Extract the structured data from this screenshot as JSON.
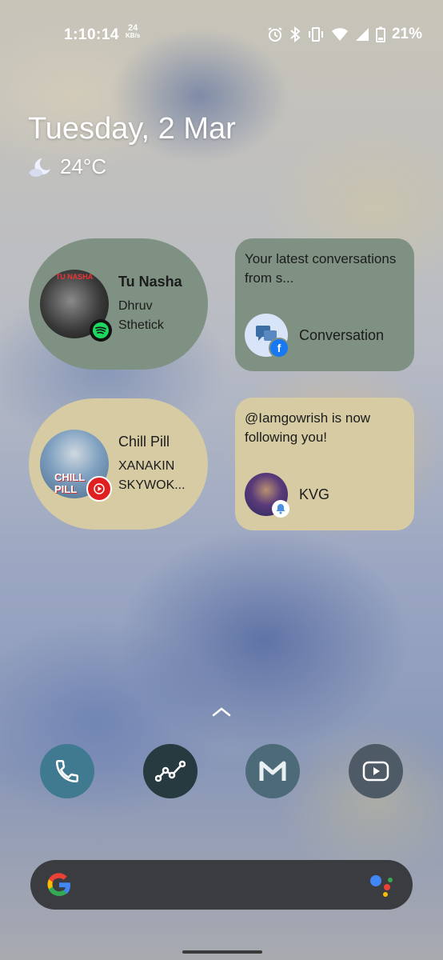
{
  "status": {
    "time": "1:10:14",
    "net_speed": "24",
    "net_unit": "KB/s",
    "battery": "21%",
    "icons": [
      "alarm-icon",
      "bluetooth-icon",
      "vibrate-icon",
      "wifi-icon",
      "signal-icon",
      "battery-icon"
    ]
  },
  "glance": {
    "date": "Tuesday, 2 Mar",
    "temperature": "24°C",
    "weather_icon": "moon-cloud-icon"
  },
  "widgets": {
    "music1": {
      "title": "Tu Nasha",
      "artist_line1": "Dhruv",
      "artist_line2": "Sthetick",
      "app_badge": "spotify-icon",
      "bg": "#7e9182"
    },
    "conversation": {
      "message": "Your latest conversations from s...",
      "label": "Conversation",
      "bg": "#7e9182"
    },
    "music2": {
      "title": "Chill Pill",
      "artist_line1": "XANAKIN",
      "artist_line2": "SKYWOK...",
      "app_badge": "youtube-music-icon",
      "bg": "#d6cba2"
    },
    "follow": {
      "message_line1": "@Iamgowrish is now",
      "message_line2": "following you!",
      "label": "KVG",
      "bg": "#d6cba2"
    }
  },
  "dock": {
    "apps": [
      "phone-app",
      "analytics-app",
      "gmail-go-app",
      "youtube-app"
    ]
  },
  "colors": {
    "accent_blue": "#3b6ea5"
  }
}
